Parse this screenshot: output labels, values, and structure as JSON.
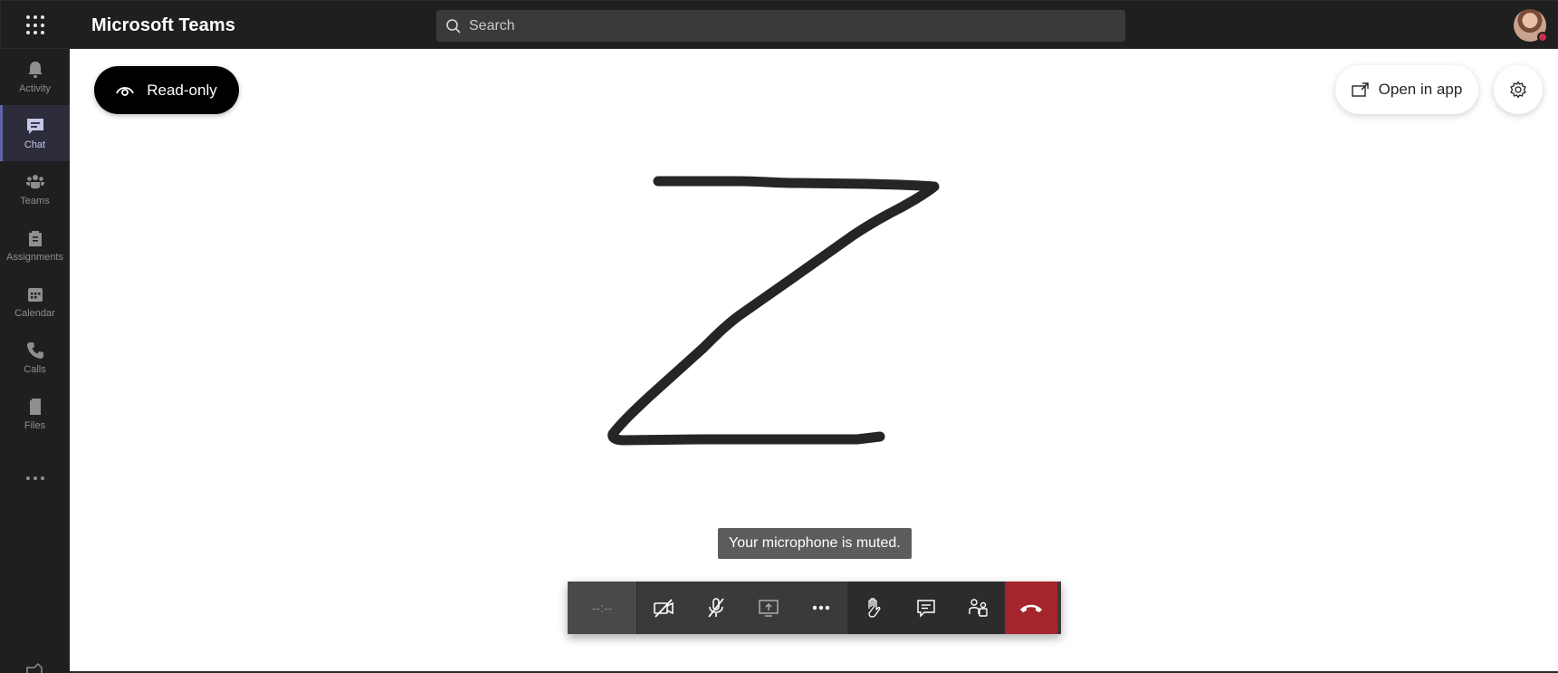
{
  "topbar": {
    "app_title": "Microsoft Teams",
    "search_placeholder": "Search"
  },
  "rail": {
    "items": [
      {
        "label": "Activity",
        "icon": "bell-icon"
      },
      {
        "label": "Chat",
        "icon": "chat-icon",
        "active": true
      },
      {
        "label": "Teams",
        "icon": "teams-icon"
      },
      {
        "label": "Assignments",
        "icon": "assignments-icon"
      },
      {
        "label": "Calendar",
        "icon": "calendar-icon"
      },
      {
        "label": "Calls",
        "icon": "phone-icon"
      },
      {
        "label": "Files",
        "icon": "file-icon"
      }
    ]
  },
  "canvas": {
    "readonly_label": "Read-only",
    "open_in_app_label": "Open in app",
    "muted_toast": "Your microphone is muted."
  },
  "call_controls": {
    "timer": "--:--",
    "buttons": [
      "camera-off-icon",
      "mic-off-icon",
      "share-screen-icon",
      "more-icon",
      "raise-hand-icon",
      "chat-bubble-icon",
      "participants-icon",
      "hang-up-icon"
    ]
  },
  "colors": {
    "rail_bg": "#1f1f1f",
    "accent": "#6264a7",
    "hangup": "#a4262c",
    "presence_busy": "#c4314b"
  }
}
